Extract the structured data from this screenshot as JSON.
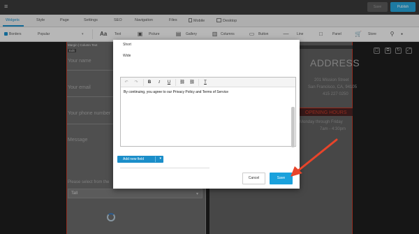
{
  "topbar": {
    "save_label": "Save",
    "publish_label": "Publish"
  },
  "tabs": [
    {
      "label": "Widgets"
    },
    {
      "label": "Style"
    },
    {
      "label": "Page"
    },
    {
      "label": "Settings"
    },
    {
      "label": "SEO"
    },
    {
      "label": "Navigation"
    },
    {
      "label": "Files"
    },
    {
      "label": "Mobile"
    },
    {
      "label": "Desktop"
    }
  ],
  "toolbar": {
    "borders_label": "Borders",
    "popular_label": "Popular",
    "items": [
      {
        "label": "Text"
      },
      {
        "label": "Picture"
      },
      {
        "label": "Gallery"
      },
      {
        "label": "Columns"
      },
      {
        "label": "Button"
      },
      {
        "label": "Line"
      },
      {
        "label": "Panel"
      },
      {
        "label": "Store"
      }
    ]
  },
  "canvas": {
    "margin_label": "Margin | Column Text",
    "edit_label": "Edit",
    "form_fields": [
      "Your name",
      "Your email",
      "Your phone number",
      "Message",
      "Please select from the"
    ],
    "select_value": "Tall",
    "address_title": "ADDRESS",
    "address_lines": [
      "201 Mission Street",
      "San Francisco, CA, 94105",
      "415 227 0250"
    ],
    "hours_title": "OPENING HOURS",
    "hours_lines": [
      "Monday through Friday",
      "7am - 4:30pm"
    ]
  },
  "modal": {
    "option_short": "Short",
    "option_wide": "Wide",
    "editor_text": "By continuing, you agree to our Privacy Policy and Terms of Service",
    "add_field_label": "Add new field",
    "cancel_label": "Cancel",
    "save_label": "Save"
  },
  "colors": {
    "accent": "#1b8ec9",
    "arrow": "#e8442a"
  }
}
